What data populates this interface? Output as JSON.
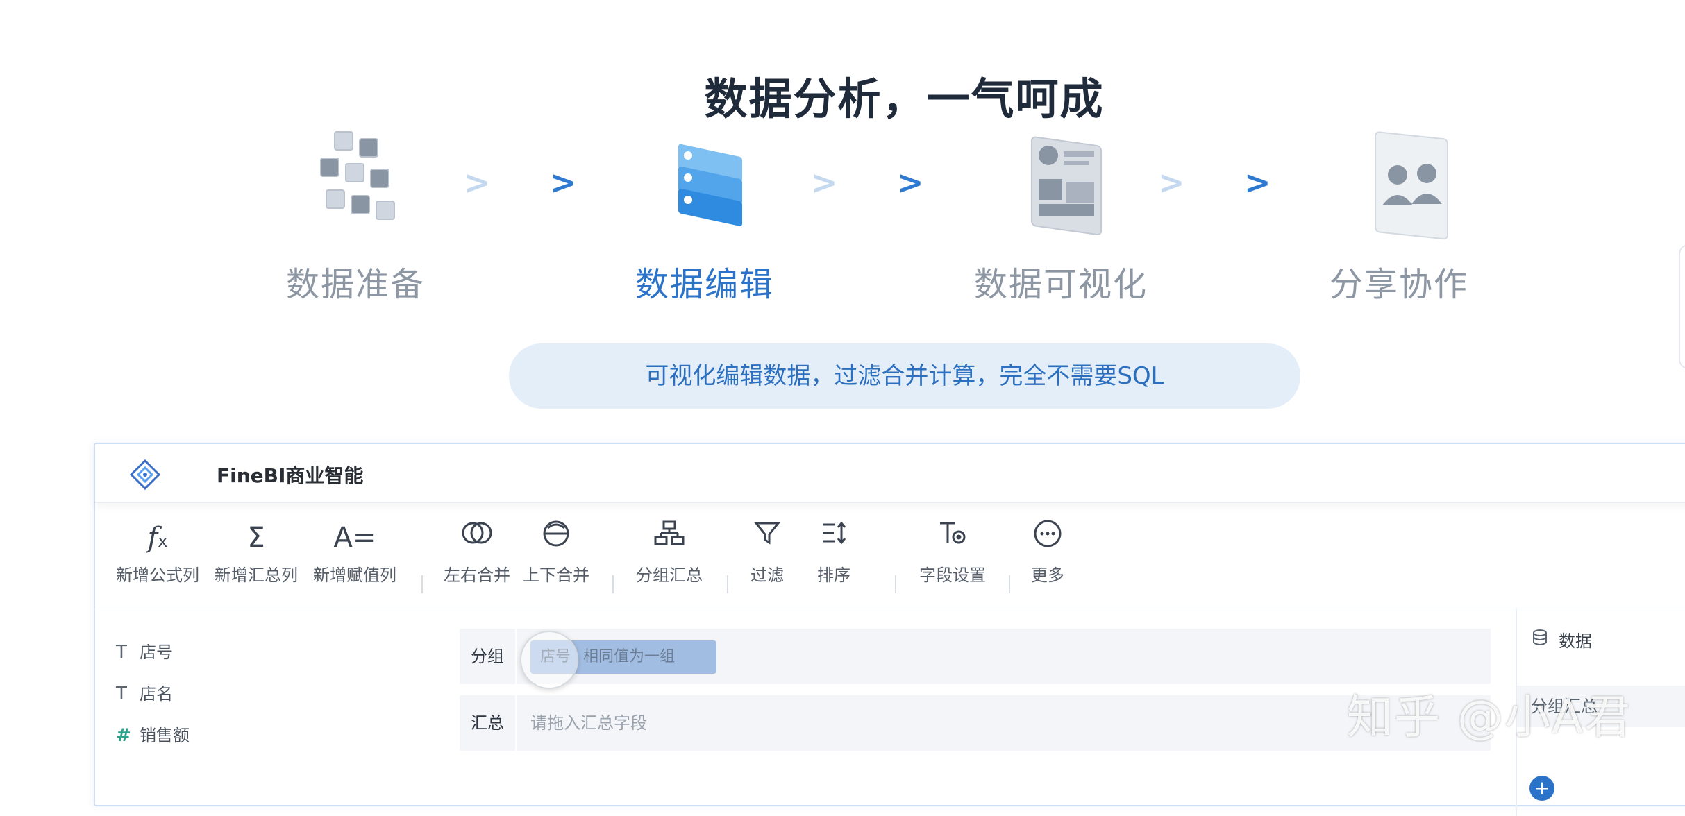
{
  "headline": "数据分析，一气呵成",
  "steps": [
    {
      "label": "数据准备",
      "icon": "data-prep-illustration"
    },
    {
      "label": "数据编辑",
      "icon": "data-edit-illustration"
    },
    {
      "label": "数据可视化",
      "icon": "data-visualization-illustration"
    },
    {
      "label": "分享协作",
      "icon": "share-collaborate-illustration"
    }
  ],
  "arrows": ">",
  "tagline": "可视化编辑数据，过滤合并计算，完全不需要SQL",
  "app": {
    "title": "FineBI商业智能",
    "toolbar": [
      {
        "label": "新增公式列",
        "icon": "fx"
      },
      {
        "label": "新增汇总列",
        "icon": "Σ"
      },
      {
        "label": "新增赋值列",
        "icon": "A="
      },
      {
        "label": "左右合并",
        "icon": "◯◯"
      },
      {
        "label": "上下合并",
        "icon": "⊖"
      },
      {
        "label": "分组汇总",
        "icon": "group-icon"
      },
      {
        "label": "过滤",
        "icon": "filter-icon"
      },
      {
        "label": "排序",
        "icon": "sort-icon"
      },
      {
        "label": "字段设置",
        "icon": "field-settings-icon"
      },
      {
        "label": "更多",
        "icon": "more-icon"
      }
    ],
    "fields": [
      {
        "type": "T",
        "name": "店号"
      },
      {
        "type": "T",
        "name": "店名"
      },
      {
        "type": "#",
        "name": "销售额"
      }
    ],
    "group_row": {
      "label": "分组",
      "chip_field": "店号",
      "chip_mode": "相同值为一组"
    },
    "summary_row": {
      "label": "汇总",
      "placeholder": "请拖入汇总字段"
    },
    "side_panel": {
      "title": "数据",
      "item": "分组汇总"
    }
  },
  "watermark": "知乎 @小A君",
  "colors": {
    "accent": "#2b72c9",
    "inactive_label": "#8d96a3",
    "tagline_bg": "#e4eef9"
  }
}
